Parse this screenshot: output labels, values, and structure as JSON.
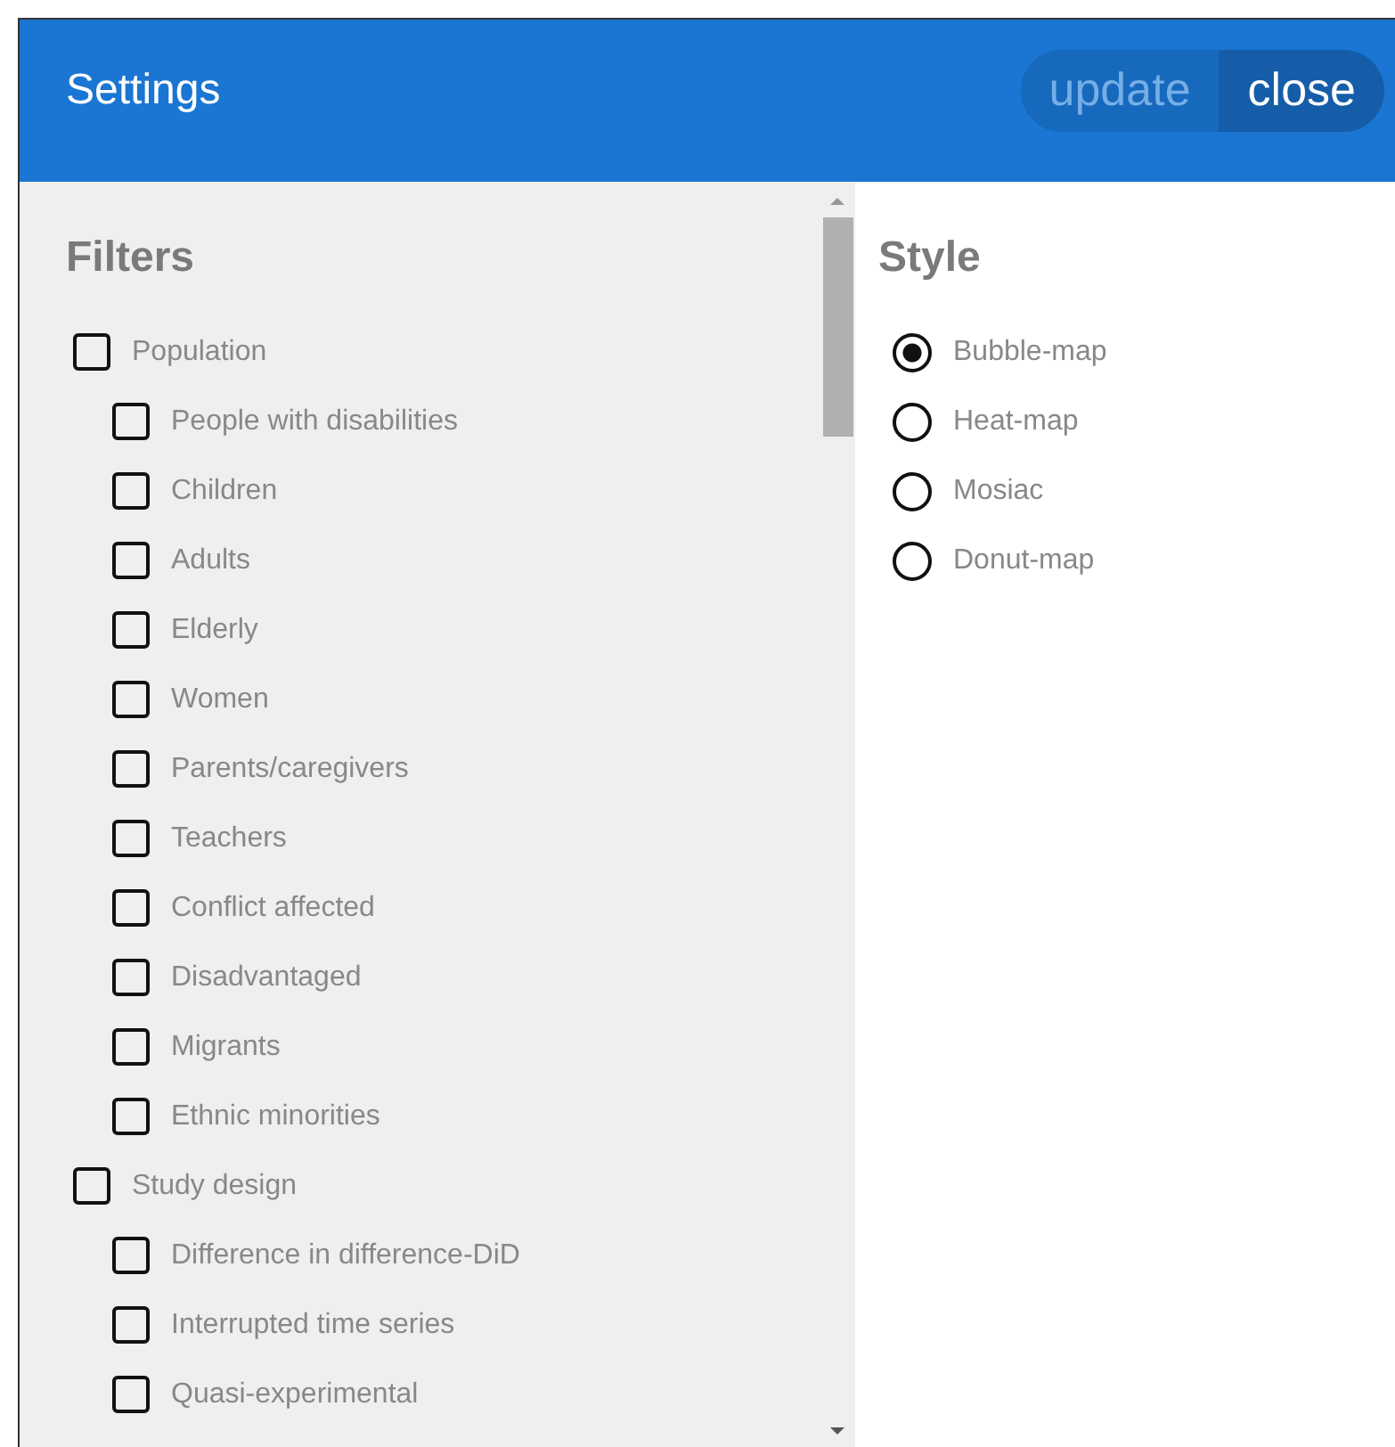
{
  "window": {
    "title": "Settings"
  },
  "header_buttons": [
    {
      "label": "update",
      "enabled": false
    },
    {
      "label": "close",
      "enabled": true
    }
  ],
  "filters": {
    "title": "Filters",
    "groups": [
      {
        "label": "Population",
        "checked": false,
        "children": [
          {
            "label": "People with disabilities",
            "checked": false
          },
          {
            "label": "Children",
            "checked": false
          },
          {
            "label": "Adults",
            "checked": false
          },
          {
            "label": "Elderly",
            "checked": false
          },
          {
            "label": "Women",
            "checked": false
          },
          {
            "label": "Parents/caregivers",
            "checked": false
          },
          {
            "label": "Teachers",
            "checked": false
          },
          {
            "label": "Conflict affected",
            "checked": false
          },
          {
            "label": "Disadvantaged",
            "checked": false
          },
          {
            "label": "Migrants",
            "checked": false
          },
          {
            "label": "Ethnic minorities",
            "checked": false
          }
        ]
      },
      {
        "label": "Study design",
        "checked": false,
        "children": [
          {
            "label": "Difference in difference-DiD",
            "checked": false
          },
          {
            "label": "Interrupted time series",
            "checked": false
          },
          {
            "label": "Quasi-experimental",
            "checked": false
          }
        ]
      }
    ]
  },
  "style": {
    "title": "Style",
    "options": [
      {
        "label": "Bubble-map",
        "selected": true
      },
      {
        "label": "Heat-map",
        "selected": false
      },
      {
        "label": "Mosiac",
        "selected": false
      },
      {
        "label": "Donut-map",
        "selected": false
      }
    ]
  }
}
